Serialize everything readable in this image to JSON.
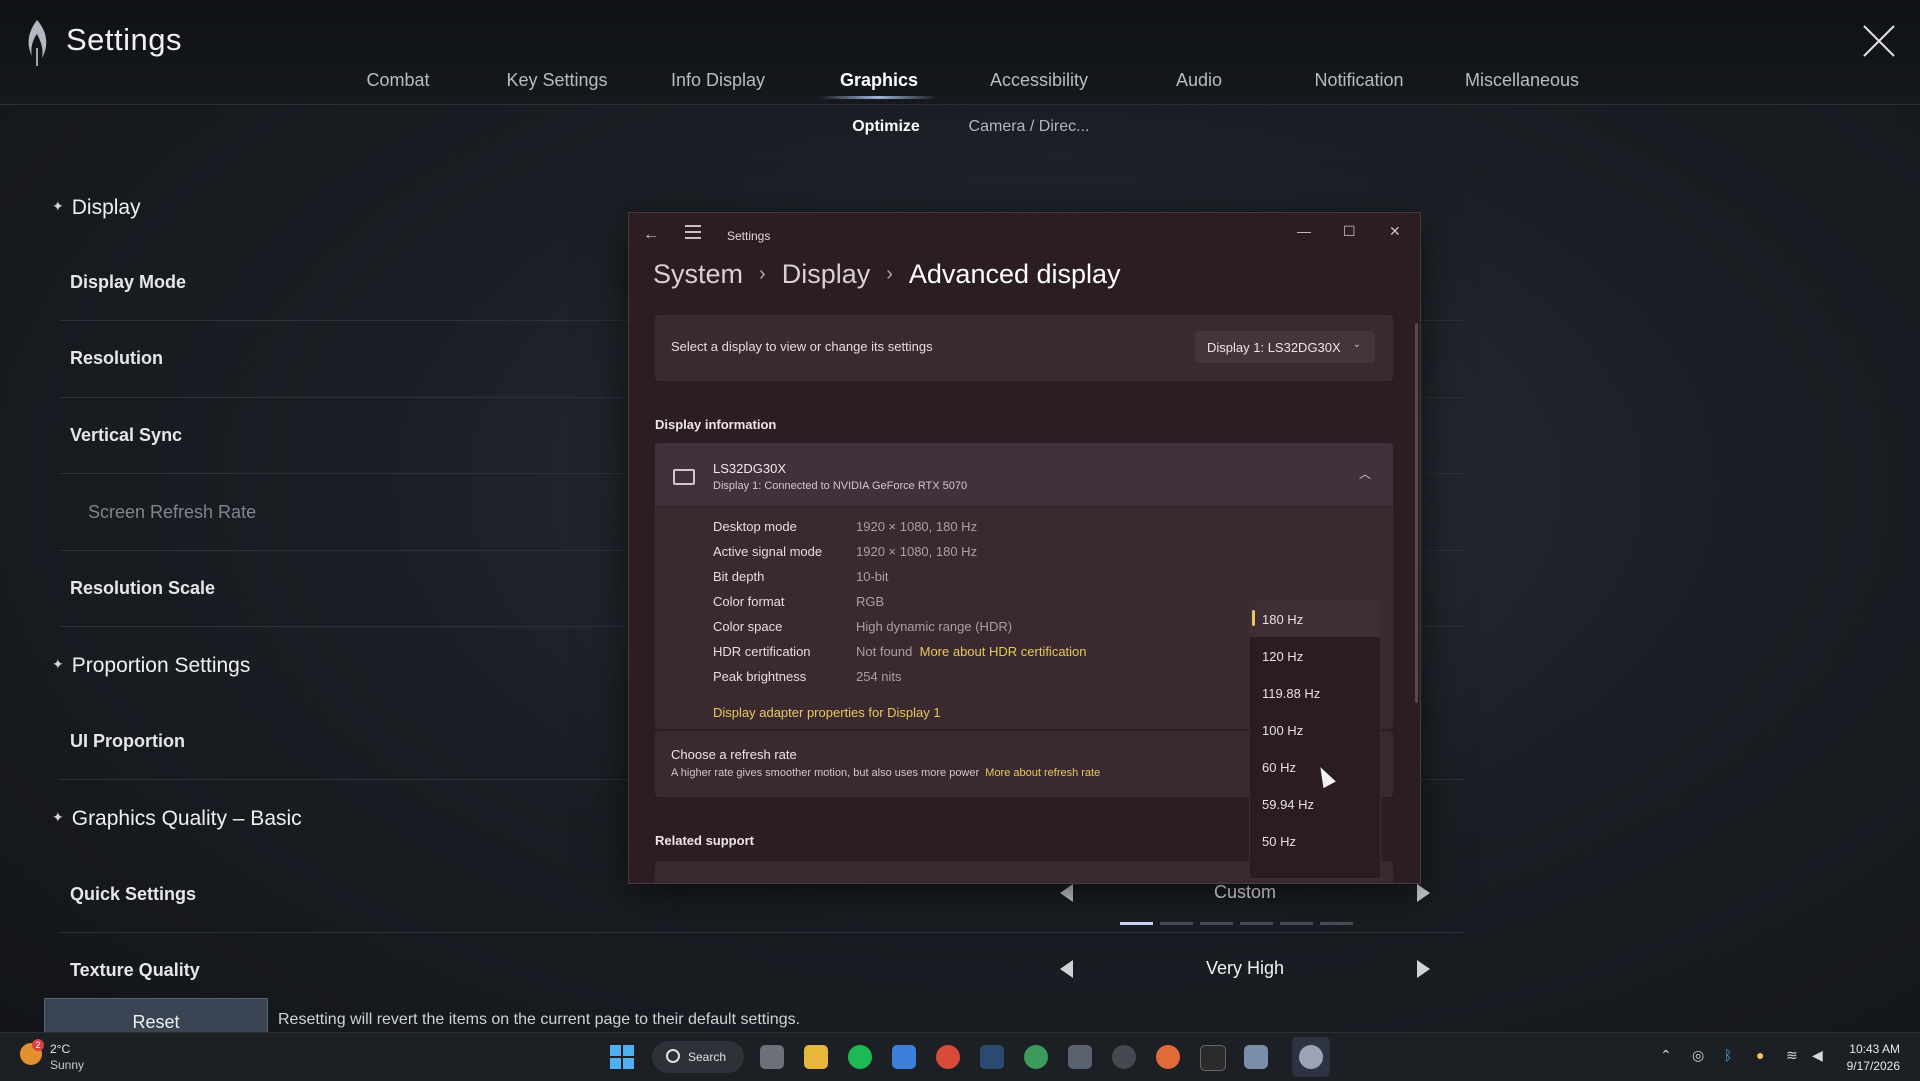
{
  "app": {
    "title": "Settings"
  },
  "tabs": [
    {
      "label": "Combat"
    },
    {
      "label": "Key Settings"
    },
    {
      "label": "Info Display"
    },
    {
      "label": "Graphics"
    },
    {
      "label": "Accessibility"
    },
    {
      "label": "Audio"
    },
    {
      "label": "Notification"
    },
    {
      "label": "Miscellaneous"
    }
  ],
  "active_tab": "Graphics",
  "subtabs": [
    {
      "label": "Optimize"
    },
    {
      "label": "Camera / Direc..."
    }
  ],
  "sections": {
    "display": {
      "title": "Display",
      "rows": [
        "Display Mode",
        "Resolution",
        "Vertical Sync",
        "Screen Refresh Rate",
        "Resolution Scale"
      ]
    },
    "proportion": {
      "title": "Proportion Settings",
      "rows": [
        "UI Proportion"
      ]
    },
    "quality": {
      "title": "Graphics Quality – Basic",
      "rows": [
        "Quick Settings",
        "Texture Quality"
      ]
    }
  },
  "selectors": {
    "quick_settings": {
      "value": "Custom",
      "step_index": 1,
      "step_count": 6
    },
    "texture_quality": {
      "value": "Very High"
    }
  },
  "footer": {
    "reset_label": "Reset",
    "reset_note": "Resetting will revert the items on the current page to their default settings."
  },
  "win_settings": {
    "title": "Settings",
    "breadcrumb": [
      "System",
      "Display",
      "Advanced display"
    ],
    "select_display_text": "Select a display to view or change its settings",
    "display_dropdown": "Display 1: LS32DG30X",
    "display_info_heading": "Display information",
    "monitor_name": "LS32DG30X",
    "monitor_sub": "Display 1: Connected to NVIDIA GeForce RTX 5070",
    "info": [
      {
        "k": "Desktop mode",
        "v": "1920 × 1080, 180 Hz"
      },
      {
        "k": "Active signal mode",
        "v": "1920 × 1080, 180 Hz"
      },
      {
        "k": "Bit depth",
        "v": "10-bit"
      },
      {
        "k": "Color format",
        "v": "RGB"
      },
      {
        "k": "Color space",
        "v": "High dynamic range (HDR)"
      },
      {
        "k": "HDR certification",
        "v": "Not found",
        "link": "More about HDR certification"
      },
      {
        "k": "Peak brightness",
        "v": "254 nits"
      }
    ],
    "adapter_link": "Display adapter properties for Display 1",
    "refresh_title": "Choose a refresh rate",
    "refresh_desc": "A higher rate gives smoother motion, but also uses more power",
    "refresh_link": "More about refresh rate",
    "related_support": "Related support",
    "refresh_options": [
      "180 Hz",
      "120 Hz",
      "119.88 Hz",
      "100 Hz",
      "60 Hz",
      "59.94 Hz",
      "50 Hz"
    ],
    "refresh_selected": "180 Hz"
  },
  "taskbar": {
    "weather_temp": "2°C",
    "weather_cond": "Sunny",
    "weather_badge": "2",
    "search_label": "Search",
    "time": "10:43 AM",
    "date": "9/17/2026"
  },
  "colors": {
    "accent_link": "#e8c85a",
    "active_tab_underline": "#9fb4d6",
    "windows_blue": "#4fb0f0"
  }
}
